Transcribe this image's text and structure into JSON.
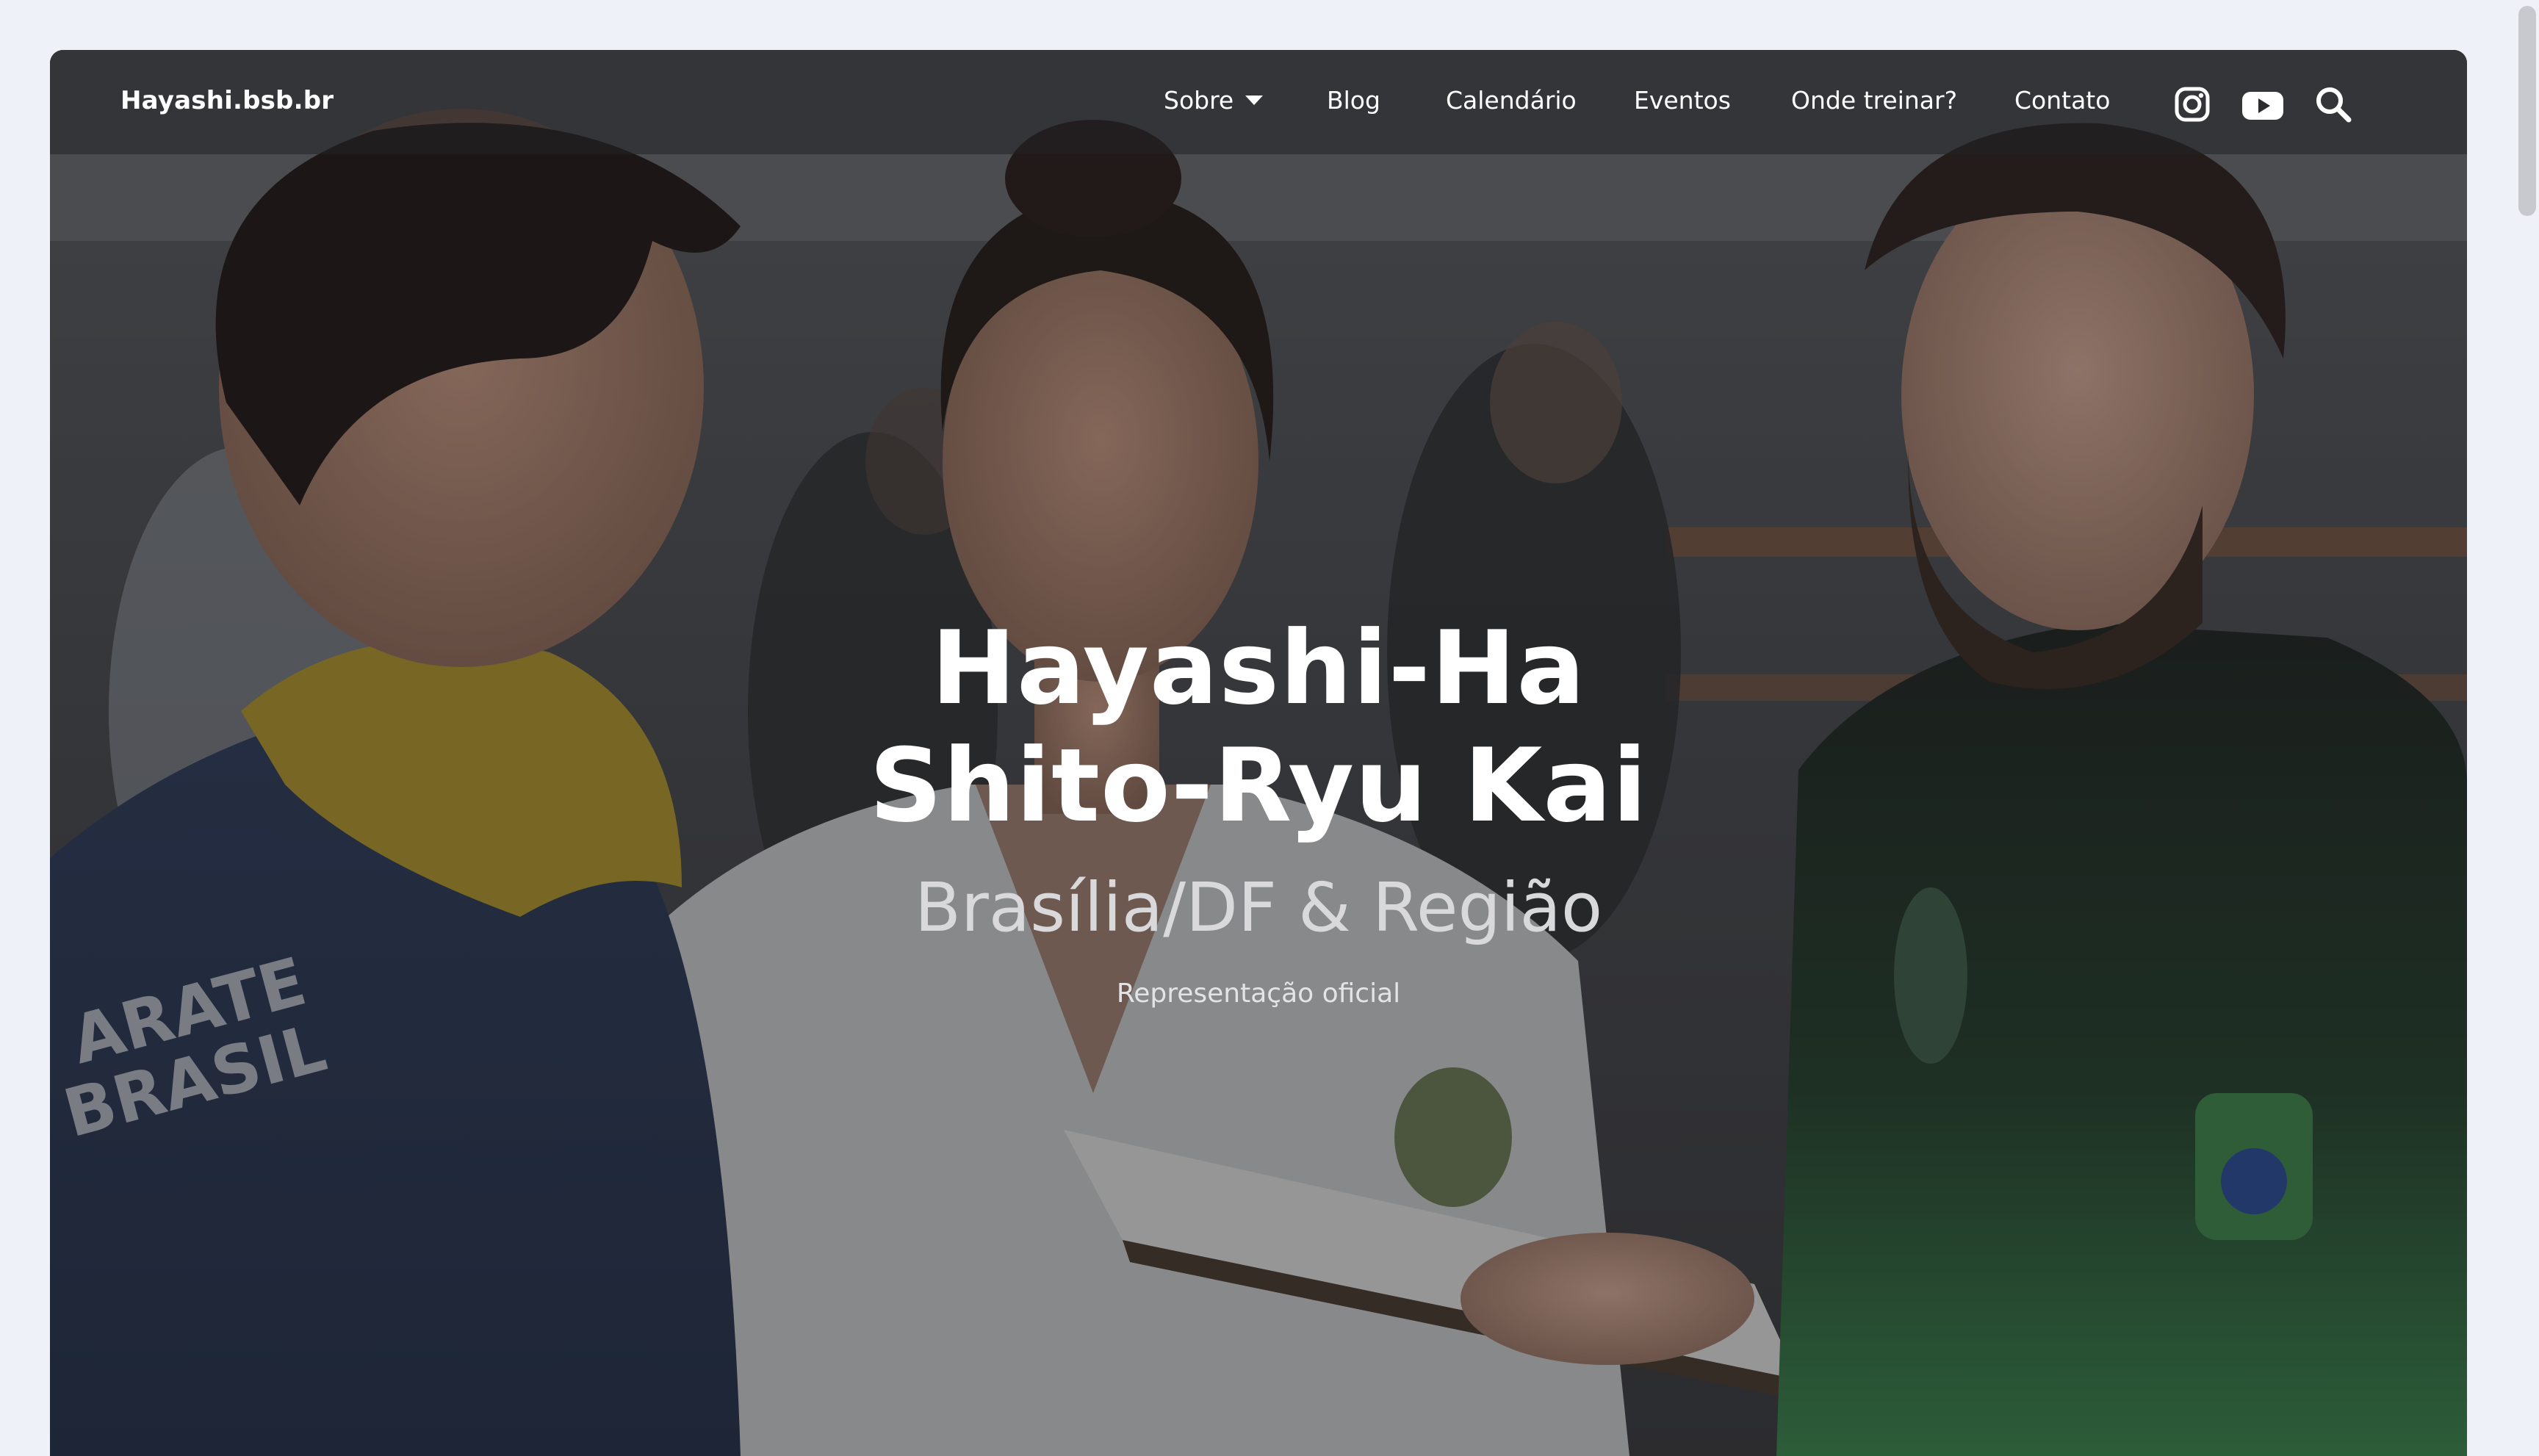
{
  "site": {
    "brand": "Hayashi.bsb.br"
  },
  "nav": {
    "items": [
      {
        "label": "Sobre",
        "has_dropdown": true
      },
      {
        "label": "Blog"
      },
      {
        "label": "Calendário"
      },
      {
        "label": "Eventos"
      },
      {
        "label": "Onde treinar?"
      },
      {
        "label": "Contato"
      }
    ],
    "icons": [
      "instagram-icon",
      "youtube-icon",
      "search-icon"
    ]
  },
  "hero": {
    "title_line1": "Hayashi-Ha",
    "title_line2": "Shito-Ryu Kai",
    "subtitle": "Brasília/DF & Região",
    "tagline": "Representação oficial"
  },
  "colors": {
    "page_background": "#eef1f8",
    "header_overlay": "#232326",
    "text": "#ffffff",
    "subtitle_text": "#d9d9dc"
  }
}
